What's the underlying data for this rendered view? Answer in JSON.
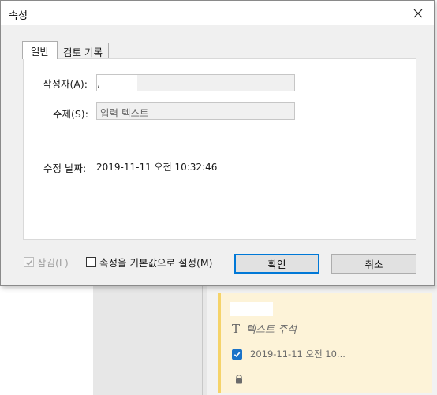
{
  "dialog": {
    "title": "속성",
    "tabs": [
      {
        "label": "일반",
        "active": true
      },
      {
        "label": "검토 기록",
        "active": false
      }
    ],
    "fields": {
      "author": {
        "label": "작성자(A):",
        "value": ","
      },
      "subject": {
        "label": "주제(S):",
        "value": "입력 텍스트"
      },
      "modified": {
        "label": "수정 날짜:",
        "value": "2019-11-11 오전 10:32:46"
      }
    },
    "footer": {
      "locked": {
        "label": "잠김(L)",
        "checked": true,
        "disabled": true
      },
      "set_default": {
        "label": "속성을 기본값으로 설정(M)",
        "checked": false
      }
    },
    "buttons": {
      "ok": "확인",
      "cancel": "취소"
    }
  },
  "comment_card": {
    "title": "텍스트 주석",
    "date": "2019-11-11  오전 10...",
    "checked": true,
    "accent_color": "#f5d36a",
    "background_color": "#fdf3d8"
  },
  "colors": {
    "primary_button_border": "#0078d7",
    "dialog_background": "#f0f0f0"
  }
}
